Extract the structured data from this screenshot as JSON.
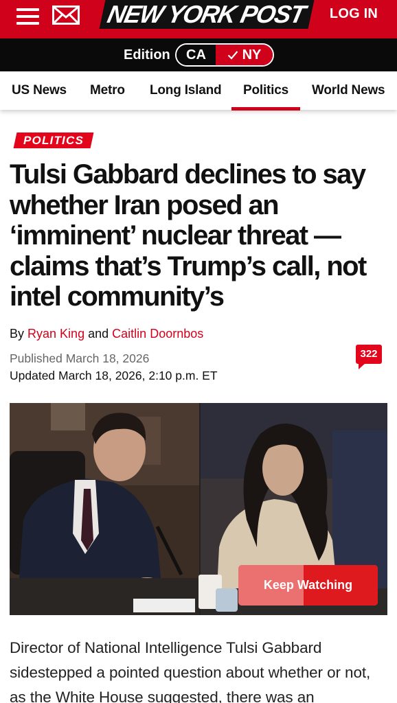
{
  "header": {
    "menu_icon": "hamburger-menu-icon",
    "mail_icon": "envelope-icon",
    "logo_text": "NEW YORK POST",
    "login_label": "LOG IN",
    "brand_color": "#d0021b"
  },
  "edition": {
    "label": "Edition",
    "options": [
      "CA",
      "NY"
    ],
    "selected": "NY",
    "check_icon": "checkmark-icon"
  },
  "nav": {
    "items": [
      "US News",
      "Metro",
      "Long Island",
      "Politics",
      "World News"
    ],
    "active": "Politics"
  },
  "article": {
    "kicker": "POLITICS",
    "headline": "Tulsi Gabbard declines to say whether Iran posed an ‘imminent’ nuclear threat — claims that’s Trump’s call, not intel community’s",
    "byline_prefix": "By",
    "author_1": "Ryan King",
    "byline_and": "and",
    "author_2": "Caitlin Doornbos",
    "published": "Published March 18, 2026",
    "updated": "Updated March 18, 2026, 2:10 p.m. ET",
    "comment_count": "322",
    "comment_icon": "comment-bubble-icon"
  },
  "video": {
    "button_label": "Keep Watching",
    "progress_fraction": 0.47
  },
  "body": {
    "paragraph_1": "Director of National Intelligence Tulsi Gabbard sidestepped a pointed question about whether or not, as the White House suggested, there was an"
  }
}
